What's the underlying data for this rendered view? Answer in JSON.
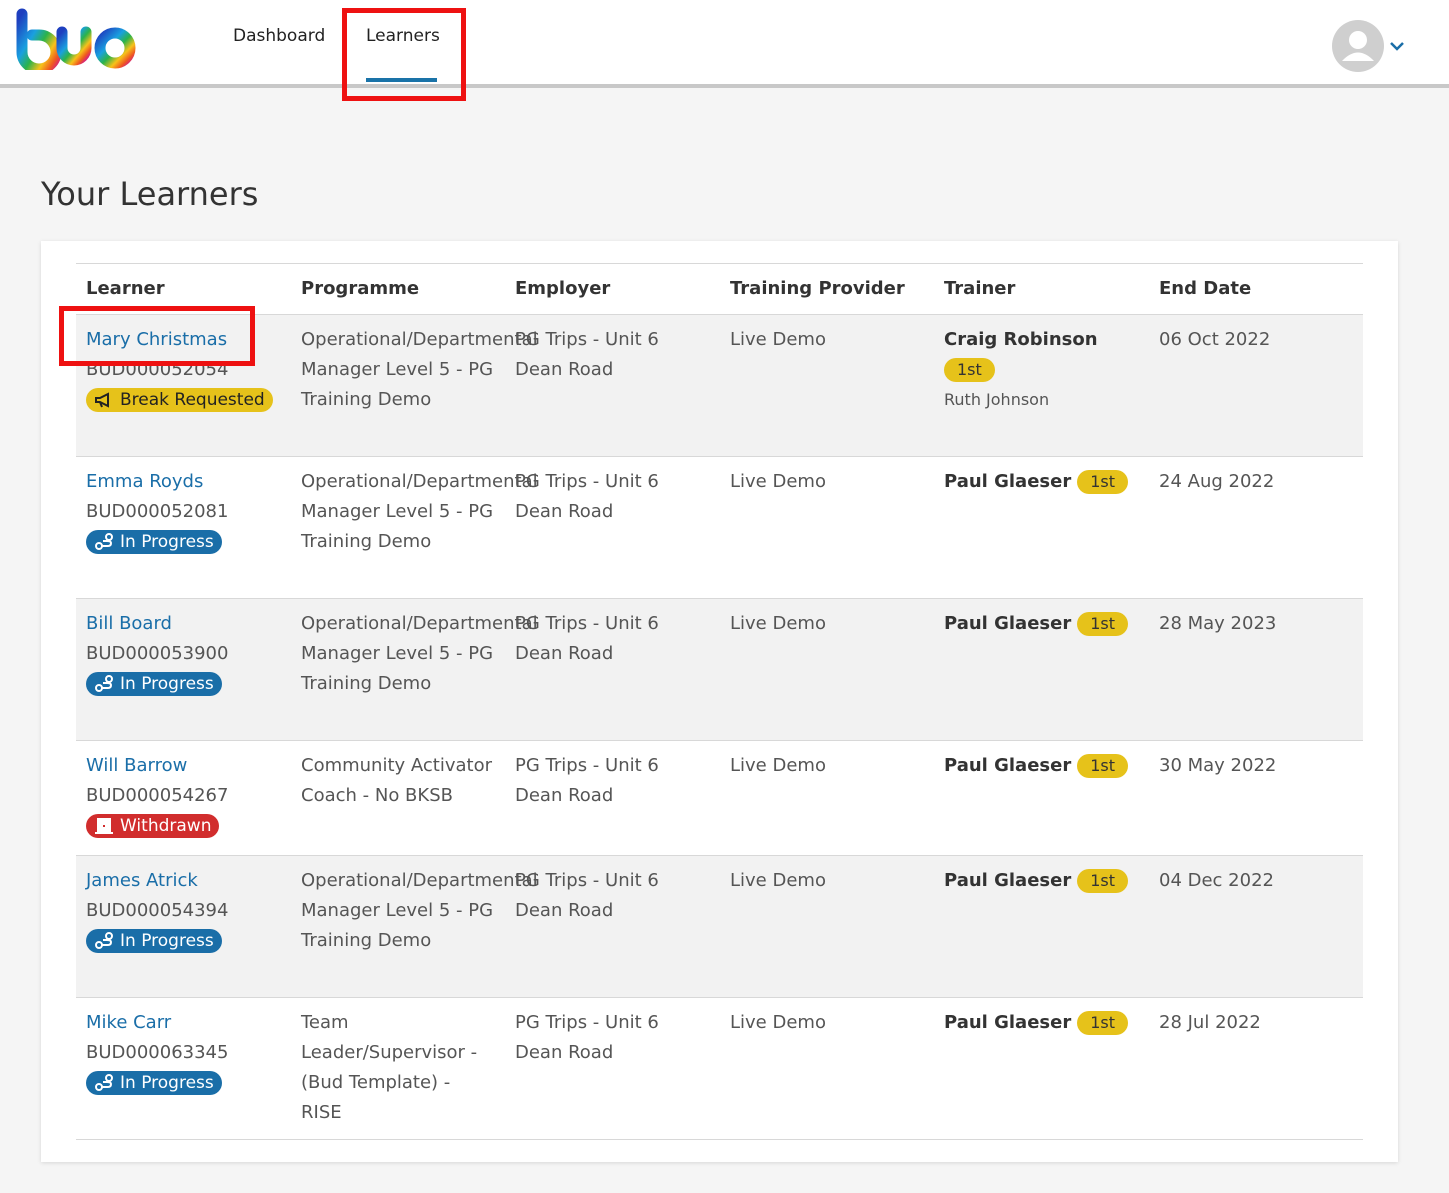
{
  "nav": {
    "logo_text": "bud",
    "items": [
      {
        "label": "Dashboard"
      },
      {
        "label": "Learners"
      }
    ]
  },
  "page": {
    "title": "Your Learners"
  },
  "table": {
    "headers": [
      "Learner",
      "Programme",
      "Employer",
      "Training Provider",
      "Trainer",
      "End Date"
    ],
    "rows": [
      {
        "name": "Mary Christmas",
        "id": "BUD000052054",
        "status": "Break Requested",
        "status_icon": "megaphone-icon",
        "programme": "Operational/Departmental Manager Level 5 - PG Training Demo",
        "employer": "PG Trips - Unit 6 Dean Road",
        "provider": "Live Demo",
        "trainer": "Craig Robinson",
        "trainer_tag": "1st",
        "trainer_secondary": "Ruth Johnson",
        "end_date": "06 Oct 2022"
      },
      {
        "name": "Emma Royds",
        "id": "BUD000052081",
        "status": "In Progress",
        "status_icon": "route-icon",
        "programme": "Operational/Departmental Manager Level 5 - PG Training Demo",
        "employer": "PG Trips - Unit 6 Dean Road",
        "provider": "Live Demo",
        "trainer": "Paul Glaeser",
        "trainer_tag": "1st",
        "end_date": "24 Aug 2022"
      },
      {
        "name": "Bill Board",
        "id": "BUD000053900",
        "status": "In Progress",
        "status_icon": "route-icon",
        "programme": "Operational/Departmental Manager Level 5 - PG Training Demo",
        "employer": "PG Trips - Unit 6 Dean Road",
        "provider": "Live Demo",
        "trainer": "Paul Glaeser",
        "trainer_tag": "1st",
        "end_date": "28 May 2023"
      },
      {
        "name": "Will Barrow",
        "id": "BUD000054267",
        "status": "Withdrawn",
        "status_icon": "exit-door-icon",
        "programme": "Community Activator Coach - No BKSB",
        "employer": "PG Trips - Unit 6 Dean Road",
        "provider": "Live Demo",
        "trainer": "Paul Glaeser",
        "trainer_tag": "1st",
        "end_date": "30 May 2022"
      },
      {
        "name": "James Atrick",
        "id": "BUD000054394",
        "status": "In Progress",
        "status_icon": "route-icon",
        "programme": "Operational/Departmental Manager Level 5 - PG Training Demo",
        "employer": "PG Trips - Unit 6 Dean Road",
        "provider": "Live Demo",
        "trainer": "Paul Glaeser",
        "trainer_tag": "1st",
        "end_date": "04 Dec 2022"
      },
      {
        "name": "Mike Carr",
        "id": "BUD000063345",
        "status": "In Progress",
        "status_icon": "route-icon",
        "programme": "Team Leader/Supervisor - (Bud Template) - RISE",
        "employer": "PG Trips - Unit 6 Dean Road",
        "provider": "Live Demo",
        "trainer": "Paul Glaeser",
        "trainer_tag": "1st",
        "end_date": "28 Jul 2022"
      }
    ]
  },
  "colors": {
    "link": "#1a6ea8",
    "badge_break": "#e6c21a",
    "badge_in_progress": "#1a6ea8",
    "badge_withdrawn": "#d12d2d",
    "highlight": "#ee1111"
  }
}
